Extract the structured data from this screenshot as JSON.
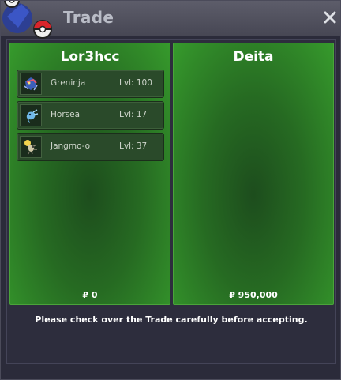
{
  "window": {
    "title": "Trade",
    "close_icon": "close-icon",
    "logo_icon": "pokeball-logo-icon"
  },
  "left_panel": {
    "player_name": "Lor3hcc",
    "money": "₽ 0",
    "items": [
      {
        "name": "Greninja",
        "level": "Lvl: 100",
        "icon": "greninja-sprite-icon"
      },
      {
        "name": "Horsea",
        "level": "Lvl: 17",
        "icon": "horsea-sprite-icon"
      },
      {
        "name": "Jangmo-o",
        "level": "Lvl: 37",
        "icon": "jangmo-o-sprite-icon"
      }
    ]
  },
  "right_panel": {
    "player_name": "Deita",
    "money": "₽ 950,000",
    "items": []
  },
  "notice": "Please check over the Trade carefully before accepting.",
  "colors": {
    "panel_green": "#369a2c",
    "panel_dark_green": "#1d4d1d",
    "window_bg": "#2b2b3a",
    "titlebar": "#5d5d6a"
  }
}
